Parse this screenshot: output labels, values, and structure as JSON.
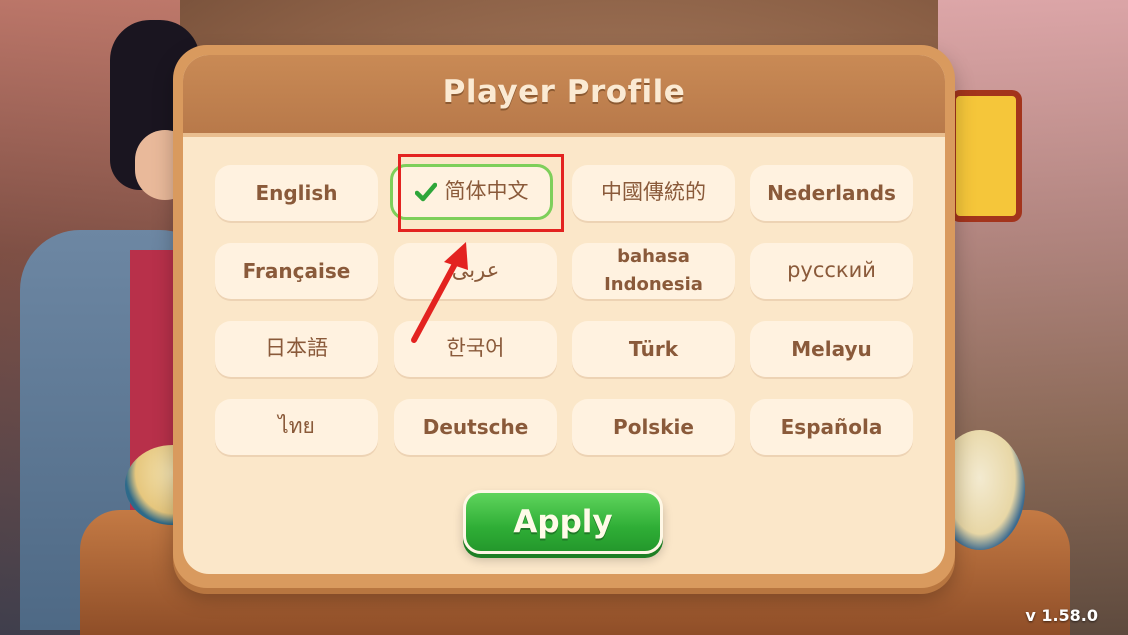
{
  "dialog": {
    "title": "Player Profile"
  },
  "languages": [
    {
      "label": "English",
      "selected": false
    },
    {
      "label": "简体中文",
      "selected": true
    },
    {
      "label": "中國傳統的",
      "selected": false
    },
    {
      "label": "Nederlands",
      "selected": false
    },
    {
      "label": "Française",
      "selected": false
    },
    {
      "label": "عربى",
      "selected": false
    },
    {
      "label": "bahasa Indonesia",
      "line1": "bahasa",
      "line2": "Indonesia",
      "selected": false
    },
    {
      "label": "русский",
      "selected": false
    },
    {
      "label": "日本語",
      "selected": false
    },
    {
      "label": "한국어",
      "selected": false
    },
    {
      "label": "Türk",
      "selected": false
    },
    {
      "label": "Melayu",
      "selected": false
    },
    {
      "label": "ไทย",
      "selected": false
    },
    {
      "label": "Deutsche",
      "selected": false
    },
    {
      "label": "Polskie",
      "selected": false
    },
    {
      "label": "Española",
      "selected": false
    }
  ],
  "apply_label": "Apply",
  "version": "v 1.58.0",
  "colors": {
    "dialog_frame": "#d99a5e",
    "dialog_bg": "#fbe7c9",
    "header_bg": "#c98a55",
    "button_bg": "#fff2e0",
    "button_text": "#8a5a3a",
    "apply_green": "#2fae36",
    "selected_border": "#7ecf5a",
    "annotation_red": "#e32320"
  },
  "icons": {
    "selected_mark": "check-icon",
    "annotation": "arrow-icon"
  }
}
